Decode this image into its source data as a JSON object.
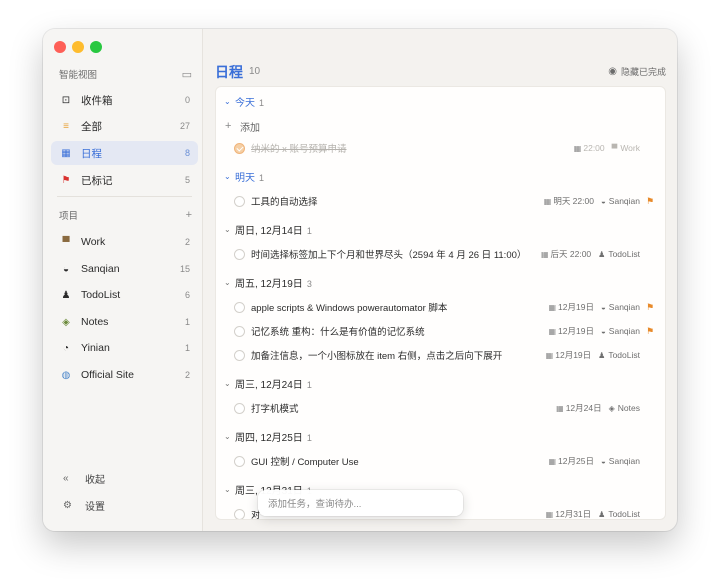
{
  "sidebar": {
    "smart_view_header": "智能视图",
    "smart_items": [
      {
        "label": "收件箱",
        "count": "0",
        "icon": "inbox-icon",
        "glyph": "⊡"
      },
      {
        "label": "全部",
        "count": "27",
        "icon": "list-icon",
        "glyph": "≡"
      },
      {
        "label": "日程",
        "count": "8",
        "icon": "calendar-icon",
        "glyph": "▦"
      },
      {
        "label": "已标记",
        "count": "5",
        "icon": "flag-icon",
        "glyph": "⚑"
      }
    ],
    "projects_header": "项目",
    "projects": [
      {
        "label": "Work",
        "count": "2",
        "icon": "work-icon",
        "glyph": "▀"
      },
      {
        "label": "Sanqian",
        "count": "15",
        "icon": "sanqian-icon",
        "glyph": "◒"
      },
      {
        "label": "TodoList",
        "count": "6",
        "icon": "todolist-icon",
        "glyph": "♟"
      },
      {
        "label": "Notes",
        "count": "1",
        "icon": "notes-icon",
        "glyph": "◈"
      },
      {
        "label": "Yinian",
        "count": "1",
        "icon": "yinian-icon",
        "glyph": "◔"
      },
      {
        "label": "Official Site",
        "count": "2",
        "icon": "globe-icon",
        "glyph": "◍"
      }
    ],
    "collapse_label": "收起",
    "settings_label": "设置"
  },
  "main": {
    "title": "日程",
    "count": "10",
    "hide_completed": "隐藏已完成"
  },
  "groups": [
    {
      "name": "今天",
      "count": "1",
      "today": true,
      "add_label": "添加",
      "tasks": [
        {
          "title": "纳米的 x 账号预算申请",
          "date": "22:00",
          "project": "Work",
          "picon": "▀",
          "flag": false,
          "done": true
        }
      ]
    },
    {
      "name": "明天",
      "count": "1",
      "today": true,
      "tasks": [
        {
          "title": "工具的自动选择",
          "date": "明天 22:00",
          "project": "Sanqian",
          "picon": "◒",
          "flag": true,
          "done": false
        }
      ]
    },
    {
      "name": "周日, 12月14日",
      "count": "1",
      "tasks": [
        {
          "title": "时间选择标签加上下个月和世界尽头（2594 年 4 月 26 日 11:00）",
          "date": "后天 22:00",
          "project": "TodoList",
          "picon": "♟",
          "flag": false,
          "done": false
        }
      ]
    },
    {
      "name": "周五, 12月19日",
      "count": "3",
      "tasks": [
        {
          "title": "apple scripts & Windows powerautomator 脚本",
          "date": "12月19日",
          "project": "Sanqian",
          "picon": "◒",
          "flag": true,
          "done": false
        },
        {
          "title": "记忆系统 重构：什么是有价值的记忆系统",
          "date": "12月19日",
          "project": "Sanqian",
          "picon": "◒",
          "flag": true,
          "done": false
        },
        {
          "title": "加备注信息，一个小图标放在 item 右侧，点击之后向下展开",
          "date": "12月19日",
          "project": "TodoList",
          "picon": "♟",
          "flag": false,
          "done": false
        }
      ]
    },
    {
      "name": "周三, 12月24日",
      "count": "1",
      "tasks": [
        {
          "title": "打字机模式",
          "date": "12月24日",
          "project": "Notes",
          "picon": "◈",
          "flag": false,
          "done": false
        }
      ]
    },
    {
      "name": "周四, 12月25日",
      "count": "1",
      "tasks": [
        {
          "title": "GUI 控制 / Computer Use",
          "date": "12月25日",
          "project": "Sanqian",
          "picon": "◒",
          "flag": false,
          "done": false
        }
      ]
    },
    {
      "name": "周三, 12月31日",
      "count": "1",
      "tasks": [
        {
          "title": "对",
          "date": "12月31日",
          "project": "TodoList",
          "picon": "♟",
          "flag": false,
          "done": false
        }
      ]
    }
  ],
  "quick_add": {
    "placeholder": "添加任务，查询待办..."
  },
  "colors": {
    "accent": "#3a6fd8",
    "flag": "#e88a2a"
  }
}
